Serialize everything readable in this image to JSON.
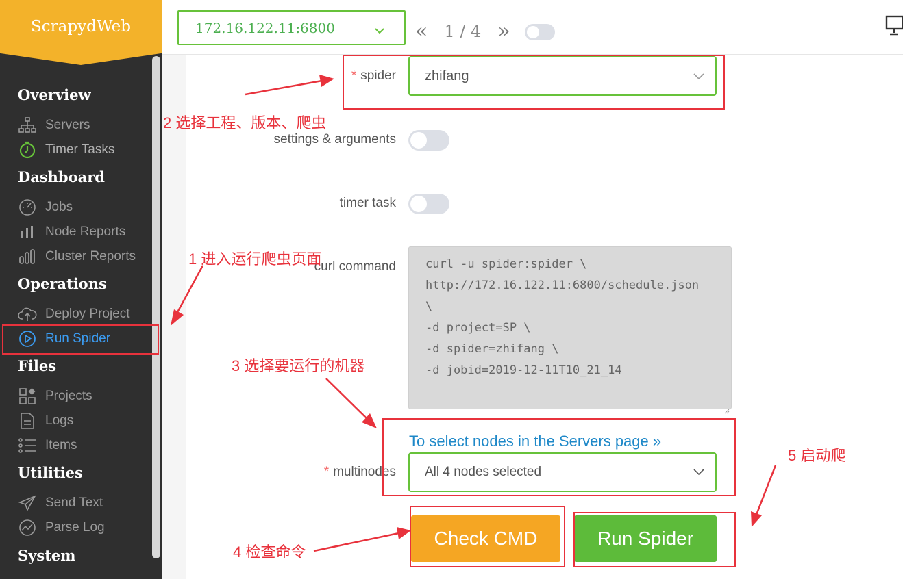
{
  "app": {
    "title": "ScrapydWeb"
  },
  "topbar": {
    "node_address": "172.16.122.11:6800",
    "pager_prev": "«",
    "pager_count": "1 / 4",
    "pager_next": "»"
  },
  "sidebar": {
    "sections": {
      "overview": "Overview",
      "dashboard": "Dashboard",
      "operations": "Operations",
      "files": "Files",
      "utilities": "Utilities",
      "system": "System"
    },
    "items": {
      "servers": "Servers",
      "timer_tasks": "Timer Tasks",
      "jobs": "Jobs",
      "node_reports": "Node Reports",
      "cluster_reports": "Cluster Reports",
      "deploy_project": "Deploy Project",
      "run_spider": "Run Spider",
      "projects": "Projects",
      "logs": "Logs",
      "items": "Items",
      "send_text": "Send Text",
      "parse_log": "Parse Log"
    },
    "active_item": "run_spider"
  },
  "form": {
    "required_mark": "*",
    "spider_label": "spider",
    "spider_value": "zhifang",
    "settings_label": "settings & arguments",
    "settings_enabled": false,
    "timer_label": "timer task",
    "timer_enabled": false,
    "curl_label": "curl command",
    "curl_lines": [
      "curl -u spider:spider \\",
      "http://172.16.122.11:6800/schedule.json",
      "\\",
      "-d project=SP \\",
      "-d spider=zhifang \\",
      "-d jobid=2019-12-11T10_21_14"
    ],
    "servers_link": "To select nodes in the Servers page »",
    "multinodes_label": "multinodes",
    "multinodes_value": "All 4 nodes selected",
    "check_button": "Check CMD",
    "run_button": "Run Spider"
  },
  "annotations": {
    "step1": "1 进入运行爬虫页面",
    "step2": "2 选择工程、版本、爬虫",
    "step3": "3 选择要运行的机器",
    "step4": "4 检查命令",
    "step5": "5 启动爬"
  },
  "colors": {
    "brand": "#f3b22a",
    "sidebar_bg": "#2f2f2f",
    "accent_green": "#67c23a",
    "active_blue": "#3b9bf0",
    "check_button": "#f5a623",
    "run_button": "#5dbb3a",
    "annotation_red": "#e8323c"
  }
}
